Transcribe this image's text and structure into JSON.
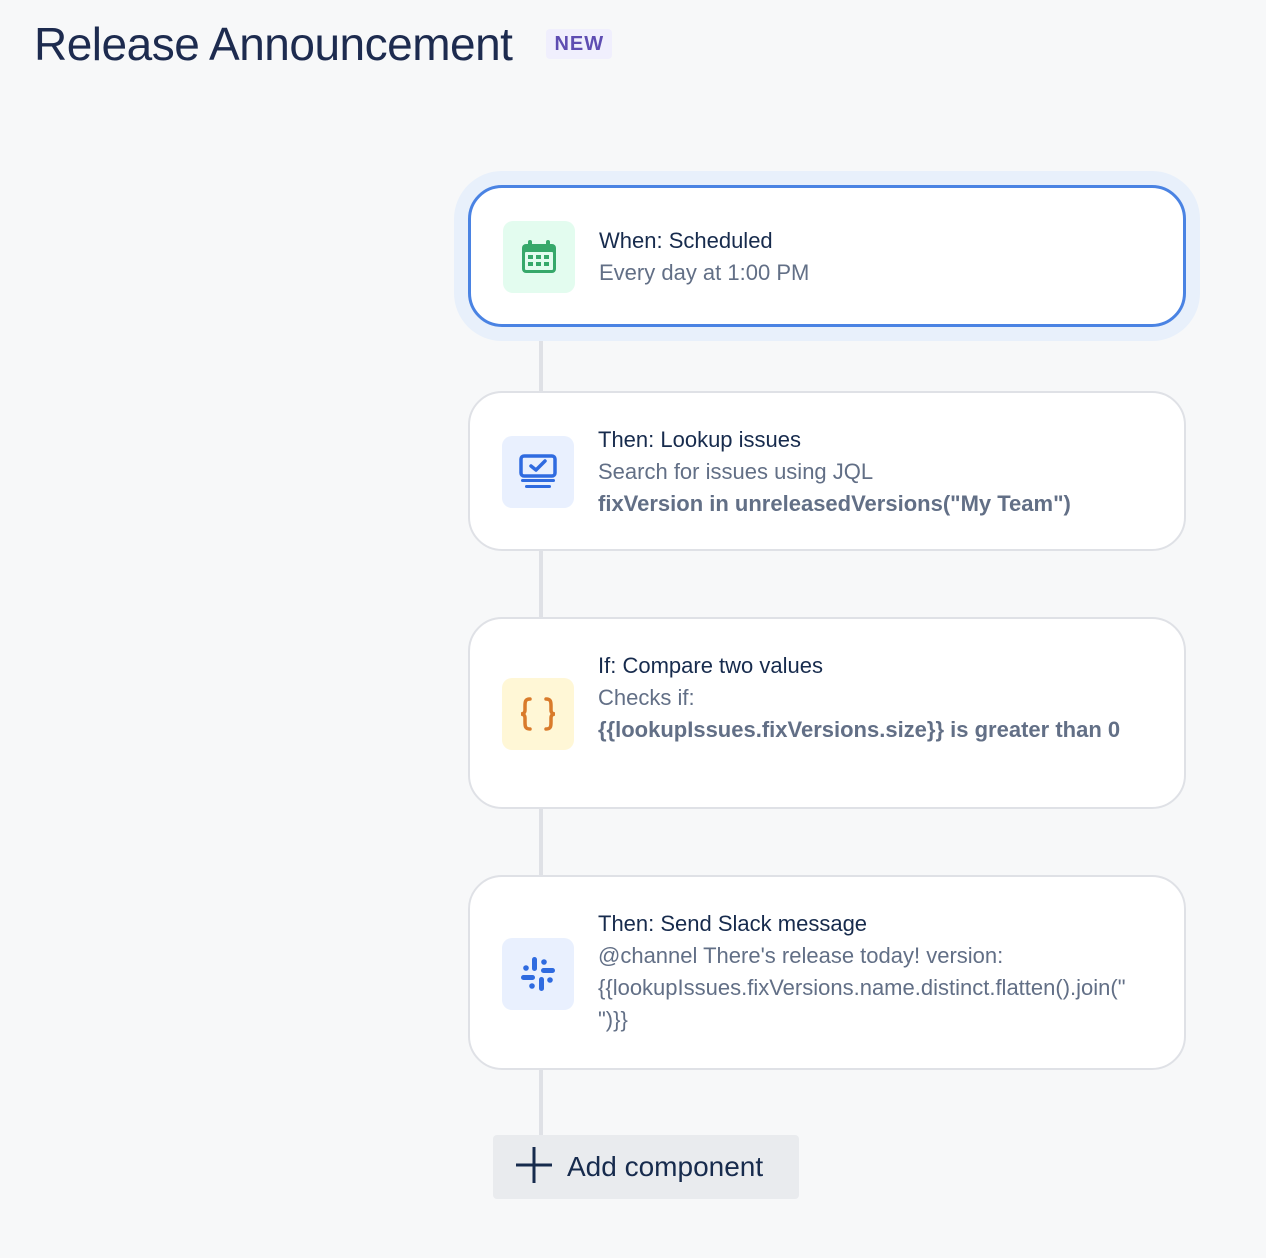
{
  "header": {
    "title": "Release Announcement",
    "badge": "NEW"
  },
  "steps": [
    {
      "icon": "calendar-icon",
      "icon_color": "#36a86a",
      "title": "When: Scheduled",
      "subtitle": "Every day at 1:00 PM"
    },
    {
      "icon": "lookup-issues-icon",
      "icon_color": "#2f6be0",
      "title": "Then: Lookup issues",
      "subtitle": "Search for issues using JQL",
      "detail": "fixVersion in unreleasedVersions(\"My Team\")"
    },
    {
      "icon": "braces-icon",
      "icon_color": "#d97b2b",
      "title": "If: Compare two values",
      "subtitle": "Checks if:",
      "detail": "{{lookupIssues.fixVersions.size}} is greater than 0"
    },
    {
      "icon": "slack-icon",
      "icon_color": "#2f6be0",
      "title": "Then: Send Slack message",
      "subtitle": "@channel There's release today! version:",
      "detail": "{{lookupIssues.fixVersions.name.distinct.flatten().join(\" \")}}"
    }
  ],
  "add_component": {
    "label": "Add component"
  },
  "colors": {
    "selected_border": "#4a83e3",
    "badge_text": "#5e4db2",
    "background": "#f7f8f9"
  }
}
